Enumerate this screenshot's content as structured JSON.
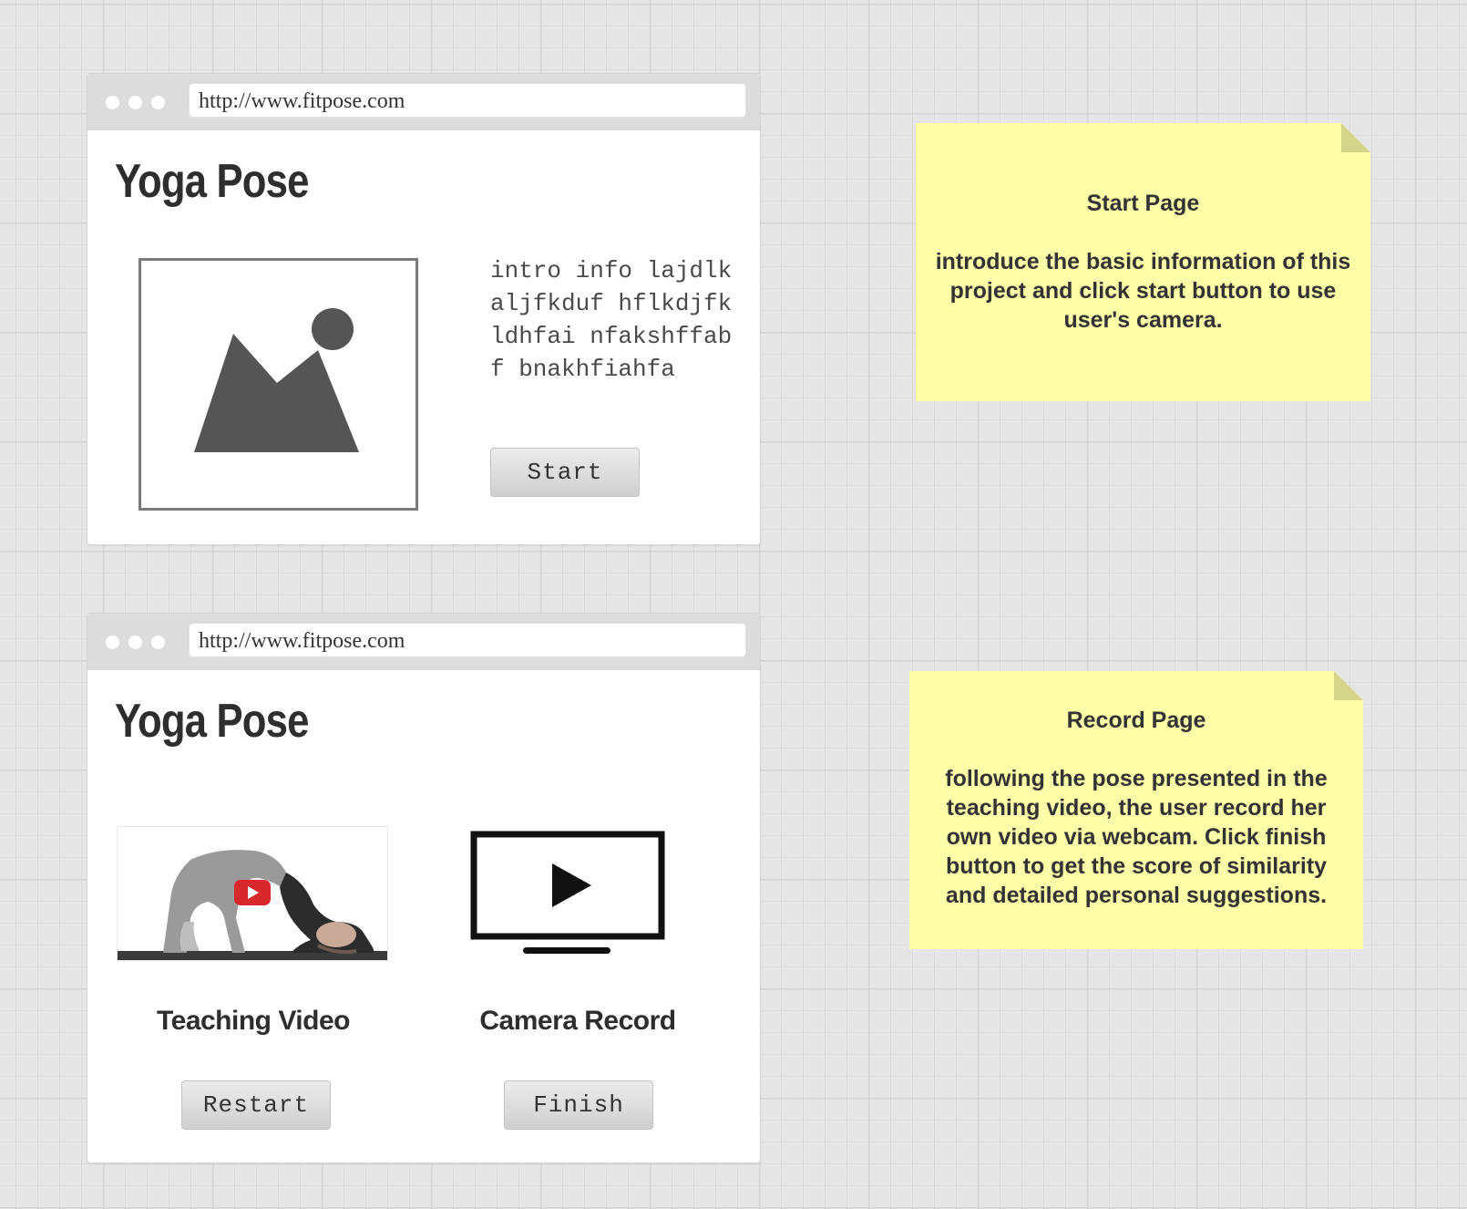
{
  "start_page": {
    "url": "http://www.fitpose.com",
    "title": "Yoga Pose",
    "intro_text": "intro info lajdlkaljfkduf hflkdjfkldhfai nfakshffabf bnakhfiahfa",
    "image_icon": "image-placeholder-icon",
    "start_button": "Start"
  },
  "record_page": {
    "url": "http://www.fitpose.com",
    "title": "Yoga Pose",
    "teaching_video_label": "Teaching Video",
    "camera_record_label": "Camera Record",
    "teaching_icon": "youtube-play-icon",
    "camera_icon": "monitor-play-icon",
    "restart_button": "Restart",
    "finish_button": "Finish"
  },
  "notes": {
    "start": {
      "title": "Start Page",
      "body": "introduce the basic information of this project and click start button to use user's camera."
    },
    "record": {
      "title": "Record Page",
      "body": "following the pose presented in the teaching video, the user record her own video via webcam. Click finish button to get the score of similarity and detailed personal suggestions."
    }
  },
  "colors": {
    "sticky_note": "#ffffa9",
    "grid_background": "#e6e6e6",
    "browser_chrome": "#dcdcdc",
    "youtube_red": "#d9282d"
  }
}
